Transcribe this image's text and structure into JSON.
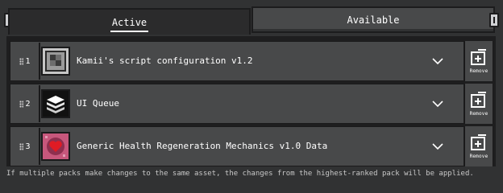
{
  "tabs": {
    "active": "Active",
    "available": "Available"
  },
  "packs": [
    {
      "rank": "1",
      "name": "Kamii's script configuration v1.2",
      "icon": "config-grid-icon"
    },
    {
      "rank": "2",
      "name": "UI Queue",
      "icon": "stack-layers-icon"
    },
    {
      "rank": "3",
      "name": "Generic Health Regeneration Mechanics v1.0 Data",
      "icon": "heart-pack-icon"
    }
  ],
  "remove_label": "Remove",
  "footer_note": "If multiple packs make changes to the same asset, the changes from the highest-ranked pack will be applied.",
  "colors": {
    "background": "#313233",
    "panel": "#1e1e1f",
    "row": "#48494a",
    "border": "#1a1a1b",
    "text": "#ffffff"
  }
}
